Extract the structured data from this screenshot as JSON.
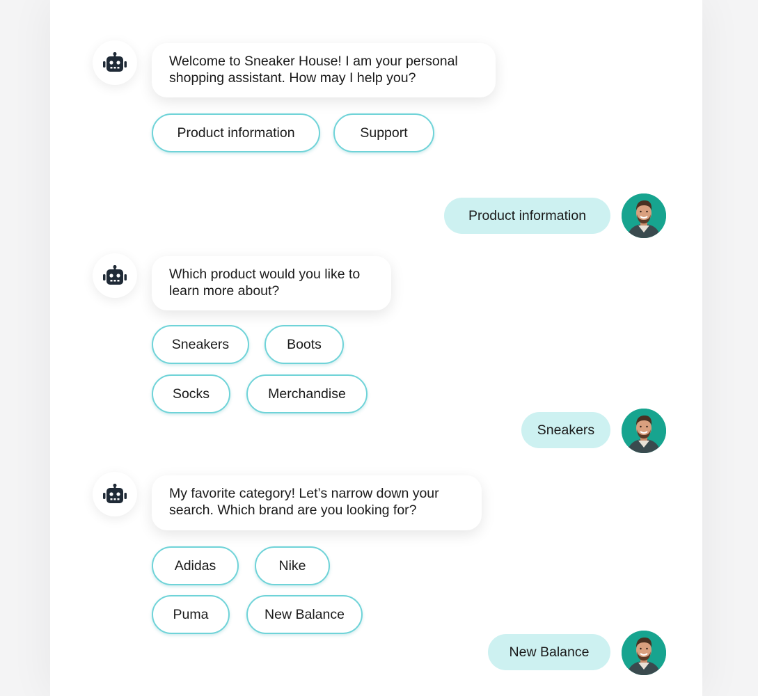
{
  "messages": [
    {
      "type": "bot",
      "avatar_icon": "robot-icon",
      "lines": [
        "Welcome to Sneaker House! I am your personal",
        "shopping assistant. How may I help you?"
      ],
      "options": [
        "Product information",
        "Support"
      ]
    },
    {
      "type": "user",
      "text": "Product information",
      "avatar_icon": "user-avatar-photo"
    },
    {
      "type": "bot",
      "avatar_icon": "robot-icon",
      "lines": [
        "Which product would you like to",
        "learn more about?"
      ],
      "options": [
        "Sneakers",
        "Boots",
        "Socks",
        "Merchandise"
      ]
    },
    {
      "type": "user",
      "text": "Sneakers",
      "avatar_icon": "user-avatar-photo"
    },
    {
      "type": "bot",
      "avatar_icon": "robot-icon",
      "lines": [
        "My favorite category! Let’s narrow down your",
        "search. Which brand are you looking for?"
      ],
      "options": [
        "Adidas",
        "Nike",
        "Puma",
        "New Balance"
      ]
    },
    {
      "type": "user",
      "text": "New Balance",
      "avatar_icon": "user-avatar-photo"
    }
  ],
  "colors": {
    "chip_border": "#6fd3d8",
    "user_bubble_bg": "#cdf1f1",
    "avatar_bg": "#17a48f",
    "robot_icon": "#1f2a36"
  }
}
